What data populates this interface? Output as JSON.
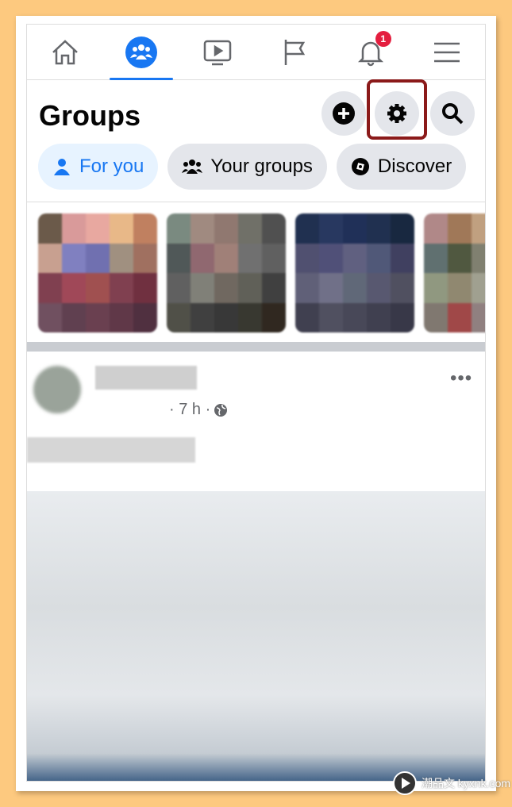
{
  "nav": {
    "tabs": [
      "home",
      "groups",
      "watch",
      "pages",
      "notifications",
      "menu"
    ],
    "notification_count": "1",
    "accent": "#1877f2"
  },
  "header": {
    "title": "Groups",
    "actions": [
      "create",
      "settings",
      "search"
    ]
  },
  "pills": [
    {
      "label": "For you",
      "icon": "person-icon"
    },
    {
      "label": "Your groups",
      "icon": "people-icon"
    },
    {
      "label": "Discover",
      "icon": "compass-icon"
    }
  ],
  "post": {
    "time": "· 7 h ·",
    "privacy": "public-globe"
  },
  "watermark": {
    "text": "潮品文 kyxnk.com",
    "highlight_color": "#8b1a1a"
  }
}
